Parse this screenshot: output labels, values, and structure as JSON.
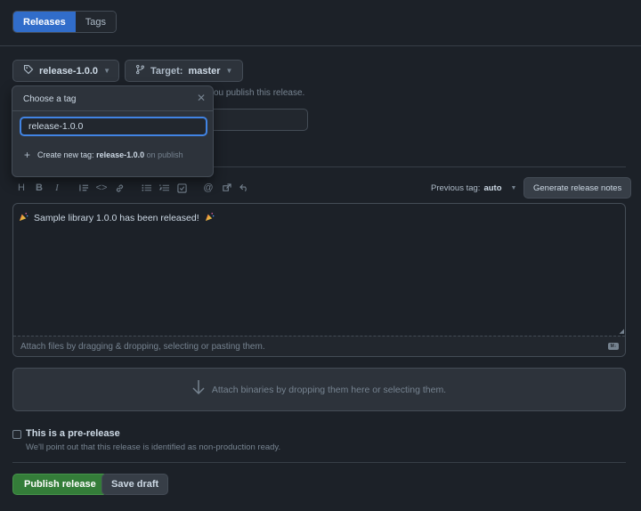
{
  "tabs": [
    {
      "label": "Releases",
      "active": true
    },
    {
      "label": "Tags",
      "active": false
    }
  ],
  "tag_button": {
    "label": "release-1.0.0",
    "icon": "tag-icon"
  },
  "target_button": {
    "prefix": "Target:",
    "value": "master",
    "icon": "branch-icon"
  },
  "hint_text": "ou publish this release.",
  "tag_dropdown": {
    "header": "Choose a tag",
    "input_value": "release-1.0.0",
    "create_prefix": "Create new tag:",
    "create_tag": "release-1.0.0",
    "create_suffix": "on publish"
  },
  "toolbar": {
    "icons": [
      "heading-icon",
      "bold-icon",
      "italic-icon",
      "quote-icon",
      "code-icon",
      "link-icon",
      "unordered-list-icon",
      "ordered-list-icon",
      "task-list-icon",
      "mention-icon",
      "reference-icon",
      "undo-icon"
    ],
    "previous_tag_label": "Previous tag:",
    "previous_tag_value": "auto",
    "generate_notes_label": "Generate release notes"
  },
  "editor": {
    "body": "Sample library 1.0.0 has been released!",
    "emoji_icon": "party-popper-icon",
    "attach_text": "Attach files by dragging & dropping, selecting or pasting them."
  },
  "binaries": {
    "text": "Attach binaries by dropping them here or selecting them."
  },
  "prerelease": {
    "checked": false,
    "label": "This is a pre-release",
    "description": "We'll point out that this release is identified as non-production ready."
  },
  "actions": {
    "publish_label": "Publish release",
    "draft_label": "Save draft"
  },
  "colors": {
    "accent": "#316dca",
    "publish": "#347d39",
    "background": "#1c2128"
  }
}
